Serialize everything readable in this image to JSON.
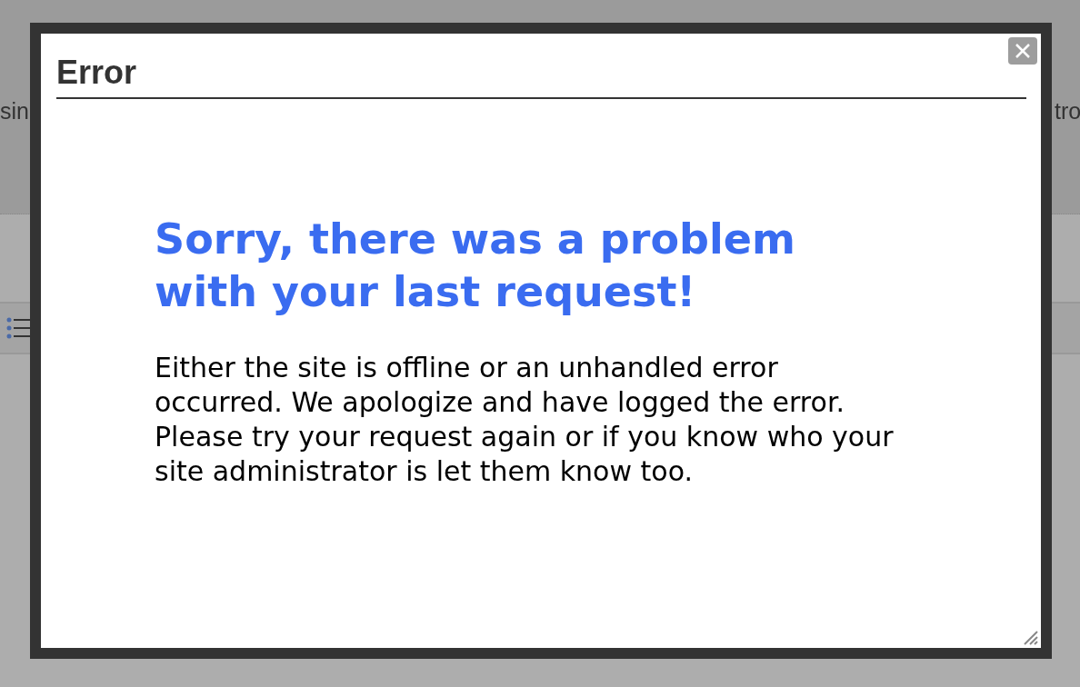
{
  "background_page": {
    "left_text": "sin",
    "right_text": "tro"
  },
  "dialog": {
    "title": "Error",
    "heading": "Sorry, there was a problem with your last request!",
    "message": "Either the site is offline or an unhandled error occurred. We apologize and have logged the error. Please try your request again or if you know who your site administrator is let them know too."
  }
}
